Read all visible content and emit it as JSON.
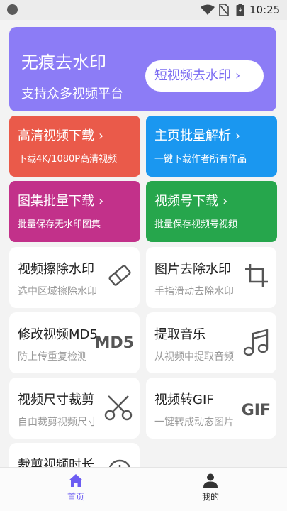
{
  "status": {
    "time": "10:25"
  },
  "hero": {
    "title": "无痕去水印",
    "subtitle": "支持众多视频平台",
    "button": "短视频去水印",
    "chevron": "›"
  },
  "colors": {
    "hero": "#8c7cf6",
    "red": "#ea5a4a",
    "blue": "#1a97f0",
    "magenta": "#c2318a",
    "green": "#26a64c",
    "accent": "#6c5cf2"
  },
  "color_cards": [
    {
      "title": "高清视频下载",
      "subtitle": "下载4K/1080P高清视频",
      "chevron": "›"
    },
    {
      "title": "主页批量解析",
      "subtitle": "一键下载作者所有作品",
      "chevron": "›"
    },
    {
      "title": "图集批量下载",
      "subtitle": "批量保存无水印图集",
      "chevron": "›"
    },
    {
      "title": "视频号下载",
      "subtitle": "批量保存视频号视频",
      "chevron": "›"
    }
  ],
  "tools": [
    {
      "title": "视频擦除水印",
      "subtitle": "选中区域擦除水印",
      "icon": "eraser-icon"
    },
    {
      "title": "图片去除水印",
      "subtitle": "手指滑动去除水印",
      "icon": "crop-icon"
    },
    {
      "title": "修改视频MD5",
      "subtitle": "防上传重复检测",
      "icon_text": "MD5"
    },
    {
      "title": "提取音乐",
      "subtitle": "从视频中提取音频",
      "icon": "music-note-icon"
    },
    {
      "title": "视频尺寸裁剪",
      "subtitle": "自由裁剪视频尺寸",
      "icon": "scissors-icon"
    },
    {
      "title": "视频转GIF",
      "subtitle": "一键转成动态图片",
      "icon_text": "GIF"
    },
    {
      "title": "裁剪视频时长",
      "subtitle": "",
      "icon": "clock-icon"
    }
  ],
  "nav": {
    "home": "首页",
    "me": "我的"
  }
}
